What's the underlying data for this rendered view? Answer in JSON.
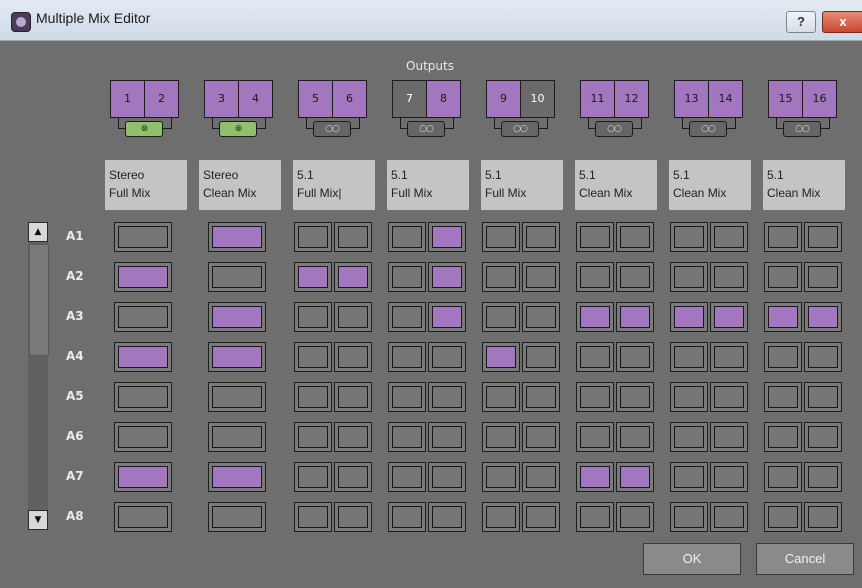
{
  "window": {
    "title": "Multiple Mix Editor",
    "help_label": "?",
    "close_label": "x"
  },
  "outputs": {
    "title": "Outputs",
    "pairs": [
      {
        "ch": [
          "1",
          "2"
        ],
        "on": [
          true,
          true
        ],
        "linked": true,
        "link_glyph": "⊗",
        "format": "Stereo",
        "name": "Full Mix"
      },
      {
        "ch": [
          "3",
          "4"
        ],
        "on": [
          true,
          true
        ],
        "linked": true,
        "link_glyph": "⊗",
        "format": "Stereo",
        "name": "Clean Mix"
      },
      {
        "ch": [
          "5",
          "6"
        ],
        "on": [
          true,
          true
        ],
        "linked": false,
        "link_glyph": "○○",
        "format": "5.1",
        "name": "Full Mix|"
      },
      {
        "ch": [
          "7",
          "8"
        ],
        "on": [
          false,
          true
        ],
        "linked": false,
        "link_glyph": "○○",
        "format": "5.1",
        "name": "Full Mix"
      },
      {
        "ch": [
          "9",
          "10"
        ],
        "on": [
          true,
          false
        ],
        "linked": false,
        "link_glyph": "○○",
        "format": "5.1",
        "name": "Full Mix"
      },
      {
        "ch": [
          "11",
          "12"
        ],
        "on": [
          true,
          true
        ],
        "linked": false,
        "link_glyph": "○○",
        "format": "5.1",
        "name": "Clean Mix"
      },
      {
        "ch": [
          "13",
          "14"
        ],
        "on": [
          true,
          true
        ],
        "linked": false,
        "link_glyph": "○○",
        "format": "5.1",
        "name": "Clean Mix"
      },
      {
        "ch": [
          "15",
          "16"
        ],
        "on": [
          true,
          true
        ],
        "linked": false,
        "link_glyph": "○○",
        "format": "5.1",
        "name": "Clean Mix"
      }
    ]
  },
  "rows": [
    {
      "label": "A1",
      "cells": [
        [
          false
        ],
        [
          true
        ],
        [
          false,
          false
        ],
        [
          false,
          true
        ],
        [
          false,
          false
        ],
        [
          false,
          false
        ],
        [
          false,
          false
        ],
        [
          false,
          false
        ]
      ]
    },
    {
      "label": "A2",
      "cells": [
        [
          true
        ],
        [
          false
        ],
        [
          true,
          true
        ],
        [
          false,
          true
        ],
        [
          false,
          false
        ],
        [
          false,
          false
        ],
        [
          false,
          false
        ],
        [
          false,
          false
        ]
      ]
    },
    {
      "label": "A3",
      "cells": [
        [
          false
        ],
        [
          true
        ],
        [
          false,
          false
        ],
        [
          false,
          true
        ],
        [
          false,
          false
        ],
        [
          true,
          true
        ],
        [
          true,
          true
        ],
        [
          true,
          true
        ]
      ]
    },
    {
      "label": "A4",
      "cells": [
        [
          true
        ],
        [
          true
        ],
        [
          false,
          false
        ],
        [
          false,
          false
        ],
        [
          true,
          false
        ],
        [
          false,
          false
        ],
        [
          false,
          false
        ],
        [
          false,
          false
        ]
      ]
    },
    {
      "label": "A5",
      "cells": [
        [
          false
        ],
        [
          false
        ],
        [
          false,
          false
        ],
        [
          false,
          false
        ],
        [
          false,
          false
        ],
        [
          false,
          false
        ],
        [
          false,
          false
        ],
        [
          false,
          false
        ]
      ]
    },
    {
      "label": "A6",
      "cells": [
        [
          false
        ],
        [
          false
        ],
        [
          false,
          false
        ],
        [
          false,
          false
        ],
        [
          false,
          false
        ],
        [
          false,
          false
        ],
        [
          false,
          false
        ],
        [
          false,
          false
        ]
      ]
    },
    {
      "label": "A7",
      "cells": [
        [
          true
        ],
        [
          true
        ],
        [
          false,
          false
        ],
        [
          false,
          false
        ],
        [
          false,
          false
        ],
        [
          true,
          true
        ],
        [
          false,
          false
        ],
        [
          false,
          false
        ]
      ]
    },
    {
      "label": "A8",
      "cells": [
        [
          false
        ],
        [
          false
        ],
        [
          false,
          false
        ],
        [
          false,
          false
        ],
        [
          false,
          false
        ],
        [
          false,
          false
        ],
        [
          false,
          false
        ],
        [
          false,
          false
        ]
      ]
    }
  ],
  "scrollbar": {
    "up_glyph": "▲",
    "down_glyph": "▼"
  },
  "buttons": {
    "ok": "OK",
    "cancel": "Cancel"
  },
  "colors": {
    "assigned": "#a277bf",
    "linked": "#8fc06b",
    "unassigned": "#767676"
  }
}
